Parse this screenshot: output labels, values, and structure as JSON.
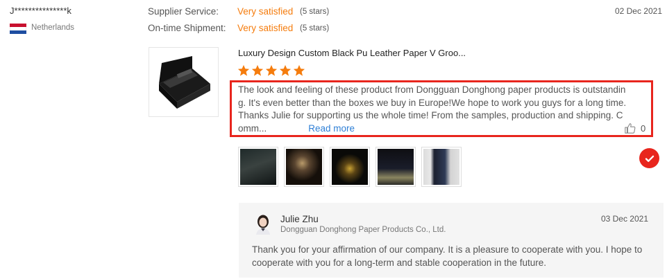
{
  "reviewer": {
    "name": "J***************k",
    "country": "Netherlands",
    "flag_colors": [
      "#c8102e",
      "#ffffff",
      "#1e4ea1"
    ]
  },
  "ratings": [
    {
      "label": "Supplier Service:",
      "value": "Very satisfied",
      "stars": "(5 stars)"
    },
    {
      "label": "On-time Shipment:",
      "value": "Very satisfied",
      "stars": "(5 stars)"
    }
  ],
  "review": {
    "date": "02 Dec 2021",
    "product_title": "Luxury Design Custom Black Pu Leather Paper V Groo...",
    "star_rating": 5,
    "star_color": "#f57c0d",
    "text": "The look and feeling of these product from Dongguan Donghong paper products is outstanding. It's even better than the boxes we buy in Europe!We hope to work you guys for a long time.Thanks Julie for supporting us the whole time! From the samples, production and shipping. Comm...",
    "read_more": "Read more",
    "likes": "0",
    "highlight_color": "#e8251d"
  },
  "reply": {
    "name": "Julie Zhu",
    "company": "Dongguan Donghong Paper Products Co., Ltd.",
    "date": "03 Dec 2021",
    "text": "Thank you for your affirmation of our company. It is a pleasure to cooperate with you. I hope to cooperate with you for a long-term and stable cooperation in the future."
  }
}
